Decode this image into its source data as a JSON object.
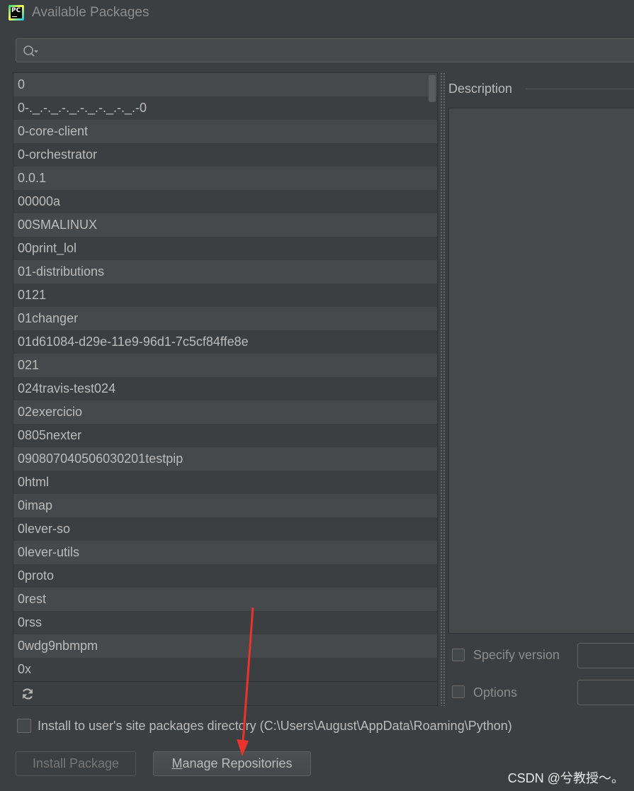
{
  "window": {
    "title": "Available Packages",
    "app_icon_text": "PC"
  },
  "search": {
    "placeholder": "",
    "value": ""
  },
  "packages": [
    "0",
    "0-._.-._.-._.-._.-._.-._.-0",
    "0-core-client",
    "0-orchestrator",
    "0.0.1",
    "00000a",
    "00SMALINUX",
    "00print_lol",
    "01-distributions",
    "0121",
    "01changer",
    "01d61084-d29e-11e9-96d1-7c5cf84ffe8e",
    "021",
    "024travis-test024",
    "02exercicio",
    "0805nexter",
    "090807040506030201testpip",
    "0html",
    "0imap",
    "0lever-so",
    "0lever-utils",
    "0proto",
    "0rest",
    "0rss",
    "0wdg9nbmpm",
    "0x"
  ],
  "description": {
    "label": "Description"
  },
  "options": {
    "specify_version_label": "Specify version",
    "options_label": "Options"
  },
  "install_to_user": {
    "label": "Install to user's site packages directory (C:\\Users\\August\\AppData\\Roaming\\Python)"
  },
  "buttons": {
    "install_package": "Install Package",
    "manage_repos_mnemonic": "M",
    "manage_repos_rest": "anage Repositories"
  },
  "watermark": "CSDN @兮教授～。",
  "colors": {
    "background": "#3c3f41",
    "row_alt": "#46494b",
    "annotation_arrow": "#e8332e"
  }
}
